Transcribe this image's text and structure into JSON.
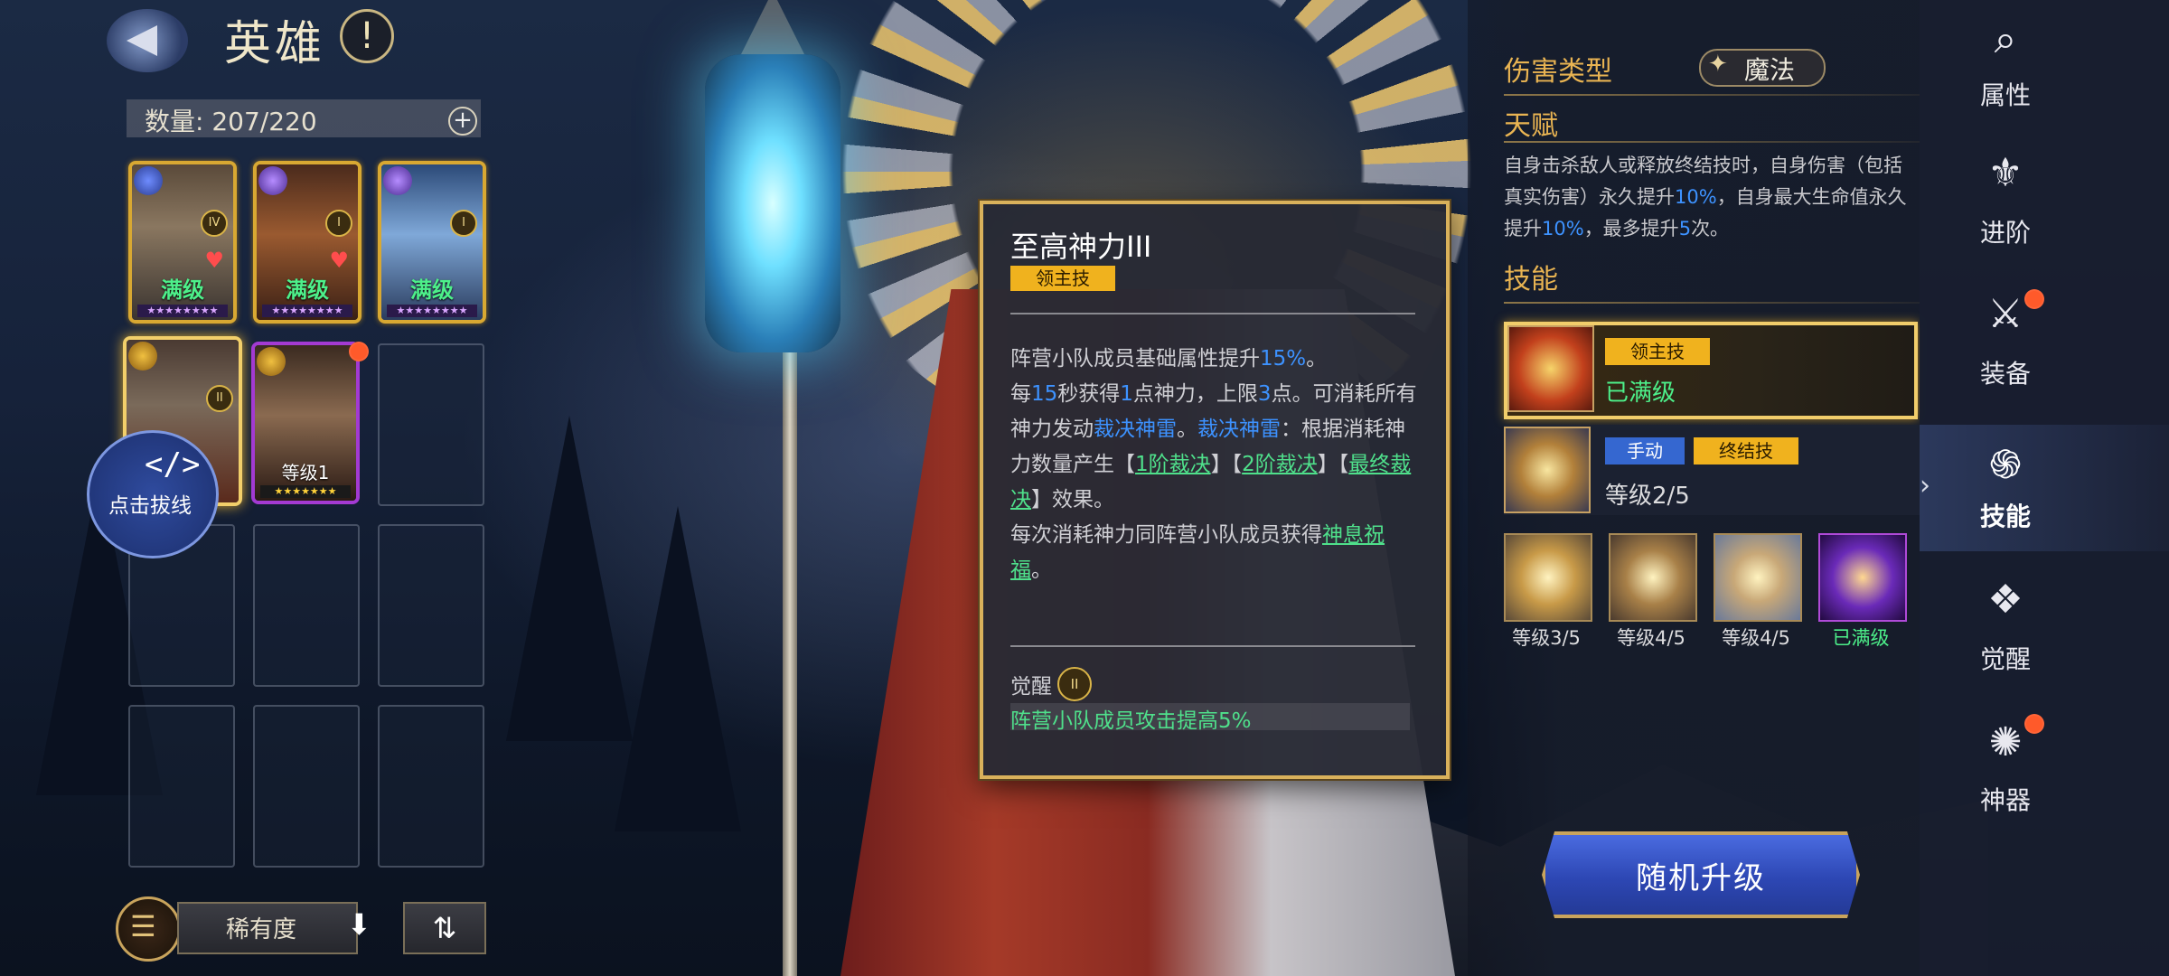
{
  "header": {
    "title": "英雄",
    "help": "!"
  },
  "roster": {
    "count_label": "数量: 207/220",
    "add": "+",
    "cards": [
      {
        "level": "满级",
        "rank": "IV",
        "stars": "★★★★★★★★"
      },
      {
        "level": "满级",
        "rank": "I",
        "stars": "★★★★★★★★"
      },
      {
        "level": "满级",
        "rank": "I",
        "stars": "★★★★★★★★"
      },
      {
        "level": "",
        "rank": "II",
        "stars": ""
      },
      {
        "level": "等级1",
        "rank": "",
        "stars": "★★★★★★★"
      }
    ],
    "unlink_label": "点击拔线",
    "sort_label": "稀有度",
    "sort_arrow": "⬇",
    "swap": "⇅"
  },
  "tooltip": {
    "title": "至高神力III",
    "badge": "领主技",
    "lines": {
      "l1a": "阵营小队成员基础属性提升",
      "l1b": "15%",
      "l1c": "。",
      "l2a": "每",
      "l2b": "15",
      "l2c": "秒获得",
      "l2d": "1",
      "l2e": "点神力，上限",
      "l2f": "3",
      "l2g": "点。可消耗所有神力发动",
      "l2h": "裁决神雷",
      "l2i": "。",
      "l2j": "裁决神雷",
      "l2k": "：根据消耗神力数量产生【",
      "l2l": "1阶裁决",
      "l2m": "】【",
      "l2n": "2阶裁决",
      "l2o": "】【",
      "l2p": "最终裁决",
      "l2q": "】效果。",
      "l3a": "每次消耗神力同阵营小队成员获得",
      "l3b": "神息祝福",
      "l3c": "。"
    },
    "awaken_label": "觉醒",
    "awaken_rank": "II",
    "awaken_text": "阵营小队成员攻击提高5%"
  },
  "info": {
    "damage_type_label": "伤害类型",
    "damage_type_value": "魔法",
    "talent_label": "天赋",
    "talent": {
      "t1": "自身击杀敌人或释放终结技时，自身伤害（包括真实伤害）永久提升",
      "t2": "10%",
      "t3": "，自身最大生命值永久提升",
      "t4": "10%",
      "t5": "，最多提升",
      "t6": "5",
      "t7": "次。"
    },
    "skills_label": "技能",
    "skill1": {
      "tag": "领主技",
      "status": "已满级"
    },
    "skill2": {
      "tag1": "手动",
      "tag2": "终结技",
      "level": "等级2/5"
    },
    "small_skills": [
      {
        "level": "等级3/5"
      },
      {
        "level": "等级4/5"
      },
      {
        "level": "等级4/5"
      },
      {
        "level": "已满级"
      }
    ],
    "upgrade_label": "随机升级"
  },
  "nav": [
    {
      "label": "属性",
      "icon": "attributes-icon"
    },
    {
      "label": "进阶",
      "icon": "advance-icon"
    },
    {
      "label": "装备",
      "icon": "equipment-icon"
    },
    {
      "label": "技能",
      "icon": "skills-icon"
    },
    {
      "label": "觉醒",
      "icon": "awaken-icon"
    },
    {
      "label": "神器",
      "icon": "artifact-icon"
    }
  ],
  "colors": {
    "accent_gold": "#e9b452",
    "highlight_blue": "#3d92ff",
    "highlight_green": "#4fe08b",
    "max_level_green": "#4df08a"
  }
}
